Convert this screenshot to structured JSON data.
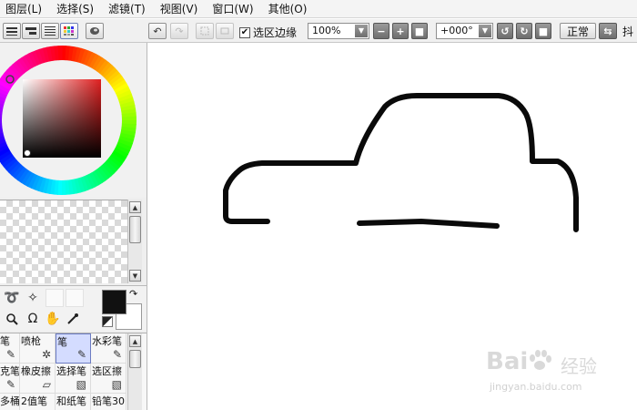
{
  "menu": [
    "图层(L)",
    "选择(S)",
    "滤镜(T)",
    "视图(V)",
    "窗口(W)",
    "其他(O)"
  ],
  "toolbar": {
    "show_selection_label": "选区边缘",
    "show_selection_checked": "✔",
    "zoom_value": "100%",
    "rotation_value": "+000°",
    "blend_mode": "正常",
    "partial_label": "抖"
  },
  "icons": {
    "undo": "↶",
    "redo": "↷",
    "minus": "−",
    "plus": "+",
    "square": "■",
    "rotate_left": "↺",
    "rotate_right": "↻",
    "flip": "⇆",
    "dropdown": "▼",
    "scroll_up": "▲",
    "scroll_down": "▼"
  },
  "tools": {
    "lasso": "➰",
    "wand": "✧",
    "zoom": "🔍",
    "rotate": "Ω",
    "hand": "✋",
    "eyedropper": "✎",
    "swap": "↷"
  },
  "colors": {
    "foreground": "#111111",
    "background": "#ffffff",
    "stroke": "#0a0a0a"
  },
  "brushes": [
    {
      "label": "笔",
      "icon": "✎"
    },
    {
      "label": "喷枪",
      "icon": "✲"
    },
    {
      "label": "笔",
      "icon": "✎",
      "selected": true
    },
    {
      "label": "水彩笔",
      "icon": "✎"
    },
    {
      "label": "克笔",
      "icon": "✎"
    },
    {
      "label": "橡皮擦",
      "icon": "▱"
    },
    {
      "label": "选择笔",
      "icon": "▧"
    },
    {
      "label": "选区擦",
      "icon": "▧"
    },
    {
      "label": "多桶",
      "icon": "◢"
    },
    {
      "label": "2值笔",
      "icon": "✎"
    },
    {
      "label": "和纸笔",
      "icon": "✎"
    },
    {
      "label": "铅笔30",
      "icon": "✎"
    }
  ],
  "watermark": {
    "logo_text": "Bai",
    "logo_suffix": "经验",
    "url": "jingyan.baidu.com"
  }
}
